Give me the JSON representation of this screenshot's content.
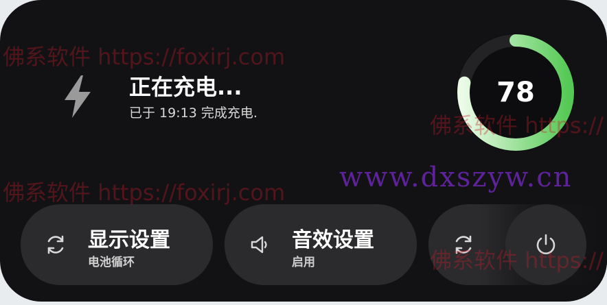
{
  "charging": {
    "title": "正在充电...",
    "subtitle": "已于 19:13 完成充电.",
    "battery_level": "78",
    "battery_fraction": 0.78
  },
  "tiles": [
    {
      "label": "显示设置",
      "sub": "电池循环",
      "icon": "refresh-icon"
    },
    {
      "label": "音效设置",
      "sub": "启用",
      "icon": "speaker-icon"
    },
    {
      "label": "",
      "sub": "",
      "icon": "refresh-icon"
    }
  ],
  "power": {
    "icon": "power-icon"
  },
  "watermarks": {
    "foxirj": "佛系软件 https://foxirj.com",
    "foxirj_partial": "佛系软件 https://",
    "dxszyw": "www.dxszyw.cn"
  },
  "colors": {
    "panel": "#121214",
    "tile": "#2b2b2e",
    "ring_start": "#e6f8e0",
    "ring_end": "#5fce5f"
  }
}
